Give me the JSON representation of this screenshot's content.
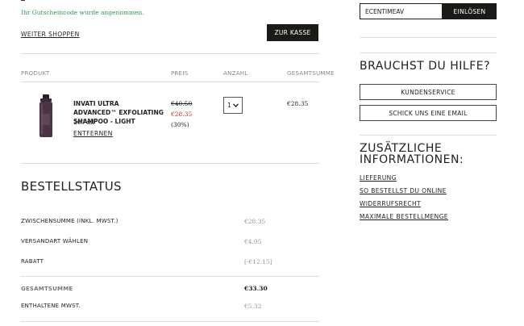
{
  "notice": "Ihr Gutscheincode wurde angenommen.",
  "actions": {
    "continue_shopping": "WEITER SHOPPEN",
    "checkout": "ZUR KASSE"
  },
  "table": {
    "headers": [
      "PRODUKT",
      "PREIS",
      "ANZAHL",
      "GESAMTSUMME"
    ],
    "item": {
      "name": "INVATI ULTRA ADVANCED™ EXFOLIATING SHAMPOO - LIGHT",
      "size": "200 ml",
      "remove": "ENTFERNEN",
      "price_old": "€40.50",
      "price_new": "€28.35",
      "discount": "(30%)",
      "quantity": "1",
      "total": "€28.35"
    }
  },
  "order_status": {
    "title": "BESTELLSTATUS",
    "rows": [
      {
        "label": "ZWISCHENSUMME (INKL. MWST.)",
        "value": "€28.35"
      },
      {
        "label": "VERSANDART WÄHLEN",
        "value": "€4.95"
      },
      {
        "label": "RABATT",
        "value": "[-€12.15]"
      }
    ],
    "total_label": "GESAMTSUMME",
    "total_value": "€33.30",
    "vat_label": "ENTHALTENE MWST.",
    "vat_value": "€5.32"
  },
  "coupon": {
    "code": "ECENTIMEAV",
    "button": "EINLÖSEN"
  },
  "help": {
    "title": "BRAUCHST DU HILFE?",
    "customer_service": "KUNDENSERVICE",
    "email": "SCHICK UNS EINE EMAIL"
  },
  "info": {
    "title": "ZUSÄTZLICHE INFORMATIONEN:",
    "links": [
      "LIEFERUNG",
      "SO BESTELLST DU ONLINE",
      "WIDERRUFSRECHT",
      "MAXIMALE BESTELLMENGE"
    ]
  },
  "colors": {
    "success": "#2c9a4e",
    "sale": "#c0333d",
    "button_dark": "#1b1a17"
  },
  "icons": {
    "product": "shampoo-bottle-icon",
    "dropdown": "chevron-down-icon"
  }
}
